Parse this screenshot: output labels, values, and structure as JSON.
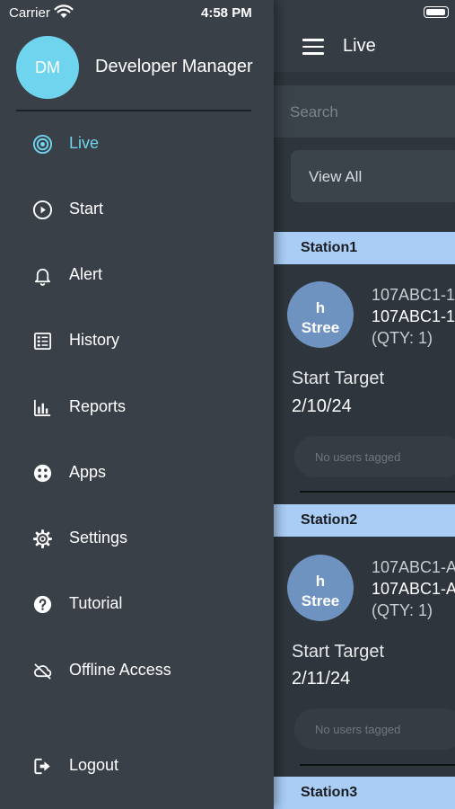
{
  "status_bar": {
    "carrier": "Carrier",
    "time": "4:58 PM"
  },
  "user": {
    "initials": "DM",
    "name": "Developer Manager"
  },
  "menu": [
    {
      "label": "Live",
      "icon": "target-icon",
      "active": true
    },
    {
      "label": "Start",
      "icon": "play-circle-icon",
      "active": false
    },
    {
      "label": "Alert",
      "icon": "bell-icon",
      "active": false
    },
    {
      "label": "History",
      "icon": "list-icon",
      "active": false
    },
    {
      "label": "Reports",
      "icon": "bar-chart-icon",
      "active": false
    },
    {
      "label": "Apps",
      "icon": "apps-icon",
      "active": false
    },
    {
      "label": "Settings",
      "icon": "gear-icon",
      "active": false
    },
    {
      "label": "Tutorial",
      "icon": "question-icon",
      "active": false
    },
    {
      "label": "Offline Access",
      "icon": "cloud-off-icon",
      "active": false
    },
    {
      "label": "Logout",
      "icon": "logout-icon",
      "active": false
    }
  ],
  "main": {
    "title": "Live",
    "search_placeholder": "Search",
    "filter_label": "View All",
    "stations": [
      {
        "name": "Station1",
        "avatar_lines": [
          "h",
          "Stree"
        ],
        "order_line1": "107ABC1-1",
        "order_line2": "107ABC1-1",
        "qty": "(QTY: 1)",
        "target_label": "Start Target",
        "target_date": "2/10/24",
        "tag_text": "No users tagged"
      },
      {
        "name": "Station2",
        "avatar_lines": [
          "h",
          "Stree"
        ],
        "order_line1": "107ABC1-A",
        "order_line2": "107ABC1-A",
        "qty": "(QTY: 1)",
        "target_label": "Start Target",
        "target_date": "2/11/24",
        "tag_text": "No users tagged"
      },
      {
        "name": "Station3"
      }
    ]
  },
  "colors": {
    "accent": "#6fd4ee",
    "drawer_bg": "#3a4047",
    "main_bg": "#2e353c",
    "station_header": "#a9cdf5",
    "station_avatar": "#6e93c1"
  }
}
